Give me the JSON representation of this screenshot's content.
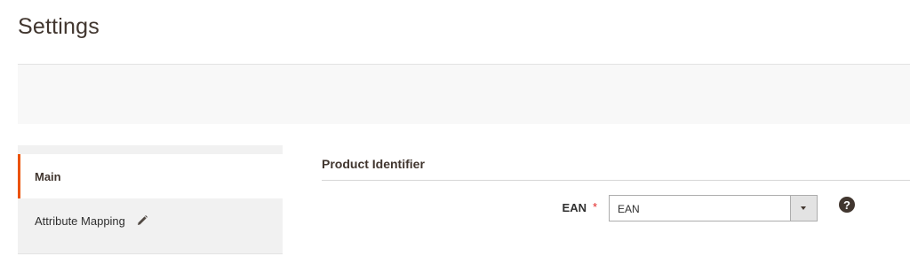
{
  "page": {
    "title": "Settings"
  },
  "sidebar": {
    "tabs": [
      {
        "label": "Main",
        "active": true
      },
      {
        "label": "Attribute Mapping",
        "icon": "pencil-icon"
      }
    ]
  },
  "section": {
    "title": "Product Identifier",
    "fields": [
      {
        "label": "EAN",
        "required": true,
        "required_mark": "*",
        "value": "EAN",
        "help_icon": "?"
      }
    ]
  },
  "colors": {
    "active_tab_accent": "#eb5202",
    "required": "#e22626",
    "help_icon": "#41362f"
  }
}
